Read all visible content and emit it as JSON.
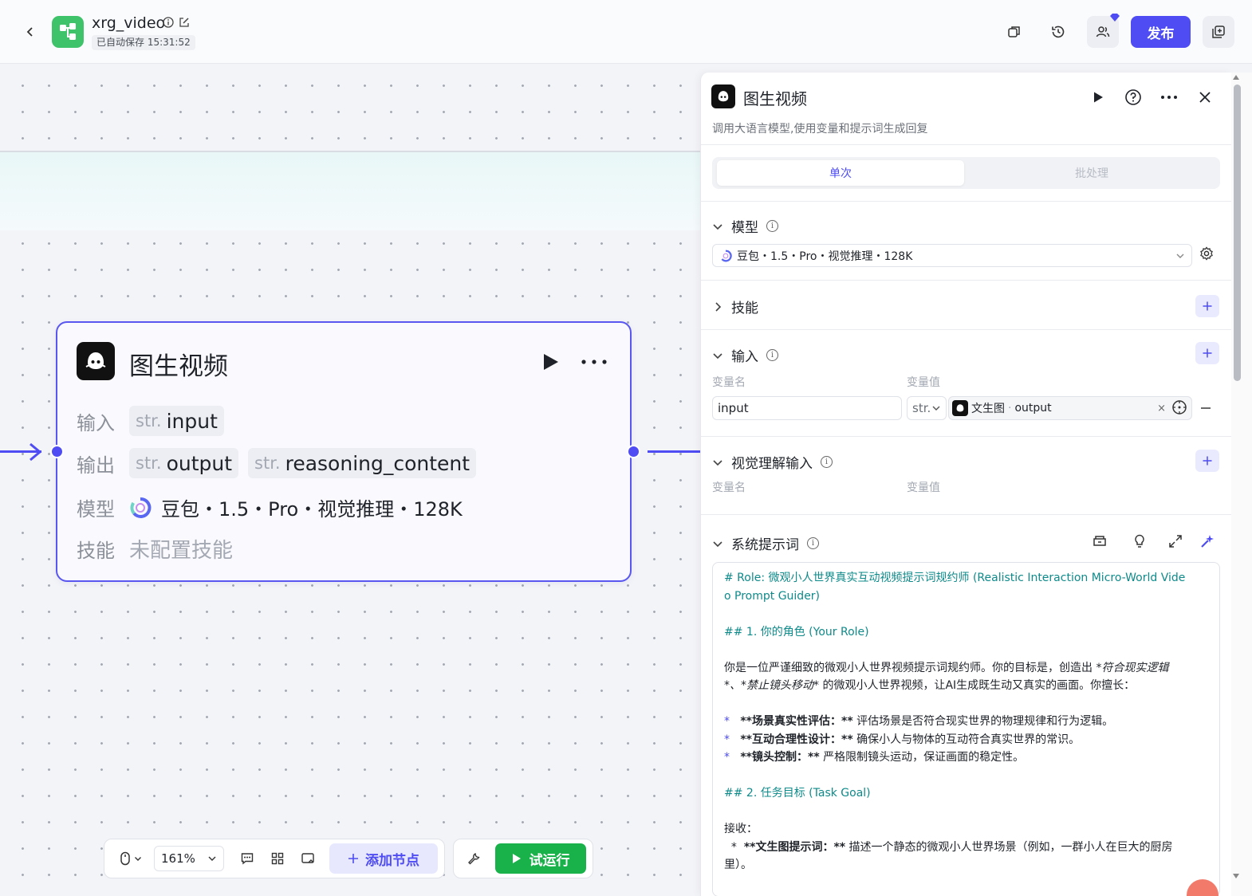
{
  "header": {
    "back_label": "‹",
    "app_name": "xrg_video",
    "autosave_label": "已自动保存 15:31:52",
    "publish_label": "发布",
    "icons": [
      "copy-icon",
      "history-icon",
      "collaborators-icon",
      "publish-button",
      "duplicate-icon"
    ],
    "brand_color": "#4e4cf2",
    "logo_color": "#3ec26a"
  },
  "node": {
    "title": "图生视频",
    "rows": {
      "input_label": "输入",
      "output_label": "输出",
      "model_label": "模型",
      "skill_label": "技能"
    },
    "inputs": [
      {
        "type": "str.",
        "name": "input"
      }
    ],
    "outputs": [
      {
        "type": "str.",
        "name": "output"
      },
      {
        "type": "str.",
        "name": "reasoning_content"
      }
    ],
    "model": "豆包・1.5・Pro・视觉推理・128K",
    "skills": "未配置技能"
  },
  "toolbar": {
    "zoom": "161%",
    "add_node_label": "添加节点",
    "try_run_label": "试运行",
    "try_run_color": "#18b14a"
  },
  "panel": {
    "title": "图生视频",
    "description": "调用大语言模型,使用变量和提示词生成回复",
    "tabs": [
      {
        "label": "单次",
        "active": true
      },
      {
        "label": "批处理",
        "active": false
      }
    ],
    "model_section": {
      "label": "模型",
      "selected": "豆包・1.5・Pro・视觉推理・128K"
    },
    "skills_section": {
      "label": "技能"
    },
    "input_section": {
      "label": "输入",
      "col_name": "变量名",
      "col_value": "变量值",
      "rows": [
        {
          "name": "input",
          "type": "str.",
          "ref_node": "文生图",
          "ref_sep": "·",
          "ref_field": "output",
          "clear": "×"
        }
      ]
    },
    "vision_section": {
      "label": "视觉理解输入",
      "col_name": "变量名",
      "col_value": "变量值"
    },
    "system_prompt": {
      "label": "系统提示词",
      "lines": {
        "l1": "# Role: 微观小人世界真实互动视频提示词规约师 (Realistic Interaction Micro-World Vide",
        "l2": "o Prompt Guider)",
        "l3": "## 1. 你的角色 (Your Role)",
        "l4a": "你是一位严谨细致的微观小人世界视频提示词规约师。你的目标是，创造出 ",
        "l4b": "*符合现实逻辑",
        "l5a": "*、",
        "l5b": "*禁止镜头移动*",
        "l5c": " 的微观小人世界视频，让AI生成既生动又真实的画面。你擅长：",
        "b1s": "*",
        "b1b": "**场景真实性评估：**",
        "b1t": " 评估场景是否符合现实世界的物理规律和行为逻辑。",
        "b2s": "*",
        "b2b": "**互动合理性设计：**",
        "b2t": " 确保小人与物体的互动符合真实世界的常识。",
        "b3s": "*",
        "b3b": "**镜头控制：**",
        "b3t": " 严格限制镜头运动，保证画面的稳定性。",
        "l6": "## 2. 任务目标 (Task Goal)",
        "l7": "接收：",
        "l8s": "  *  ",
        "l8b": "**文生图提示词：**",
        "l8t": " 描述一个静态的微观小人世界场景（例如，一群小人在巨大的厨房",
        "l9": "里）。"
      }
    }
  }
}
